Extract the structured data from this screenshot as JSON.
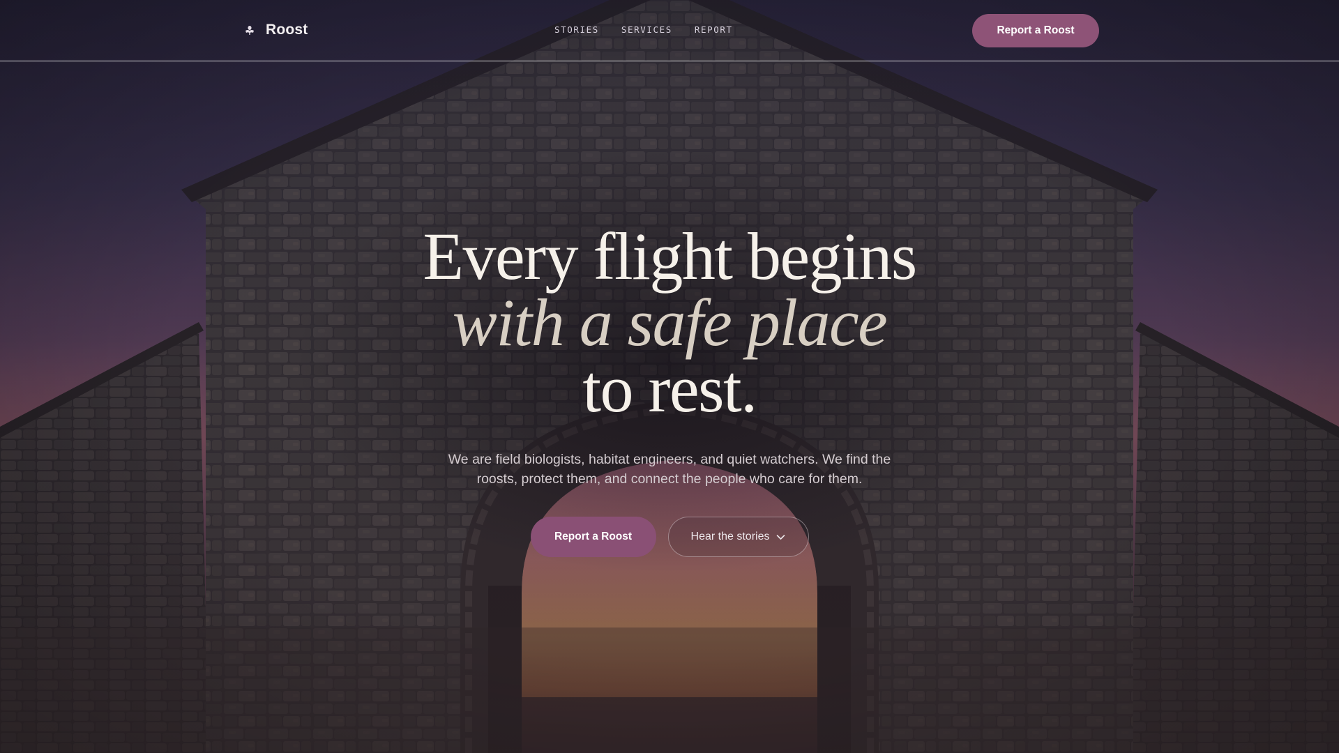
{
  "header": {
    "brand": {
      "icon": "bat-icon",
      "name": "Roost"
    },
    "nav": [
      {
        "label": "STORIES"
      },
      {
        "label": "SERVICES"
      },
      {
        "label": "REPORT"
      }
    ],
    "cta_label": "Report a Roost"
  },
  "hero": {
    "headline_line1": "Every flight begins",
    "headline_line2": "with a safe place",
    "headline_line3": "to rest.",
    "subtitle": "We are field biologists, habitat engineers, and quiet watchers. We find the roosts, protect them, and connect the people who care for them.",
    "primary_cta": "Report a Roost",
    "secondary_cta": "Hear the stories",
    "secondary_cta_icon": "chevron-down-icon"
  },
  "background": {
    "image": "stone barn with arched doorway at sunset"
  },
  "colors": {
    "accent": "#8a5075",
    "sky_top": "#3a3350",
    "sky_horizon": "#b56a6e",
    "text_light": "#f6f1ea"
  }
}
